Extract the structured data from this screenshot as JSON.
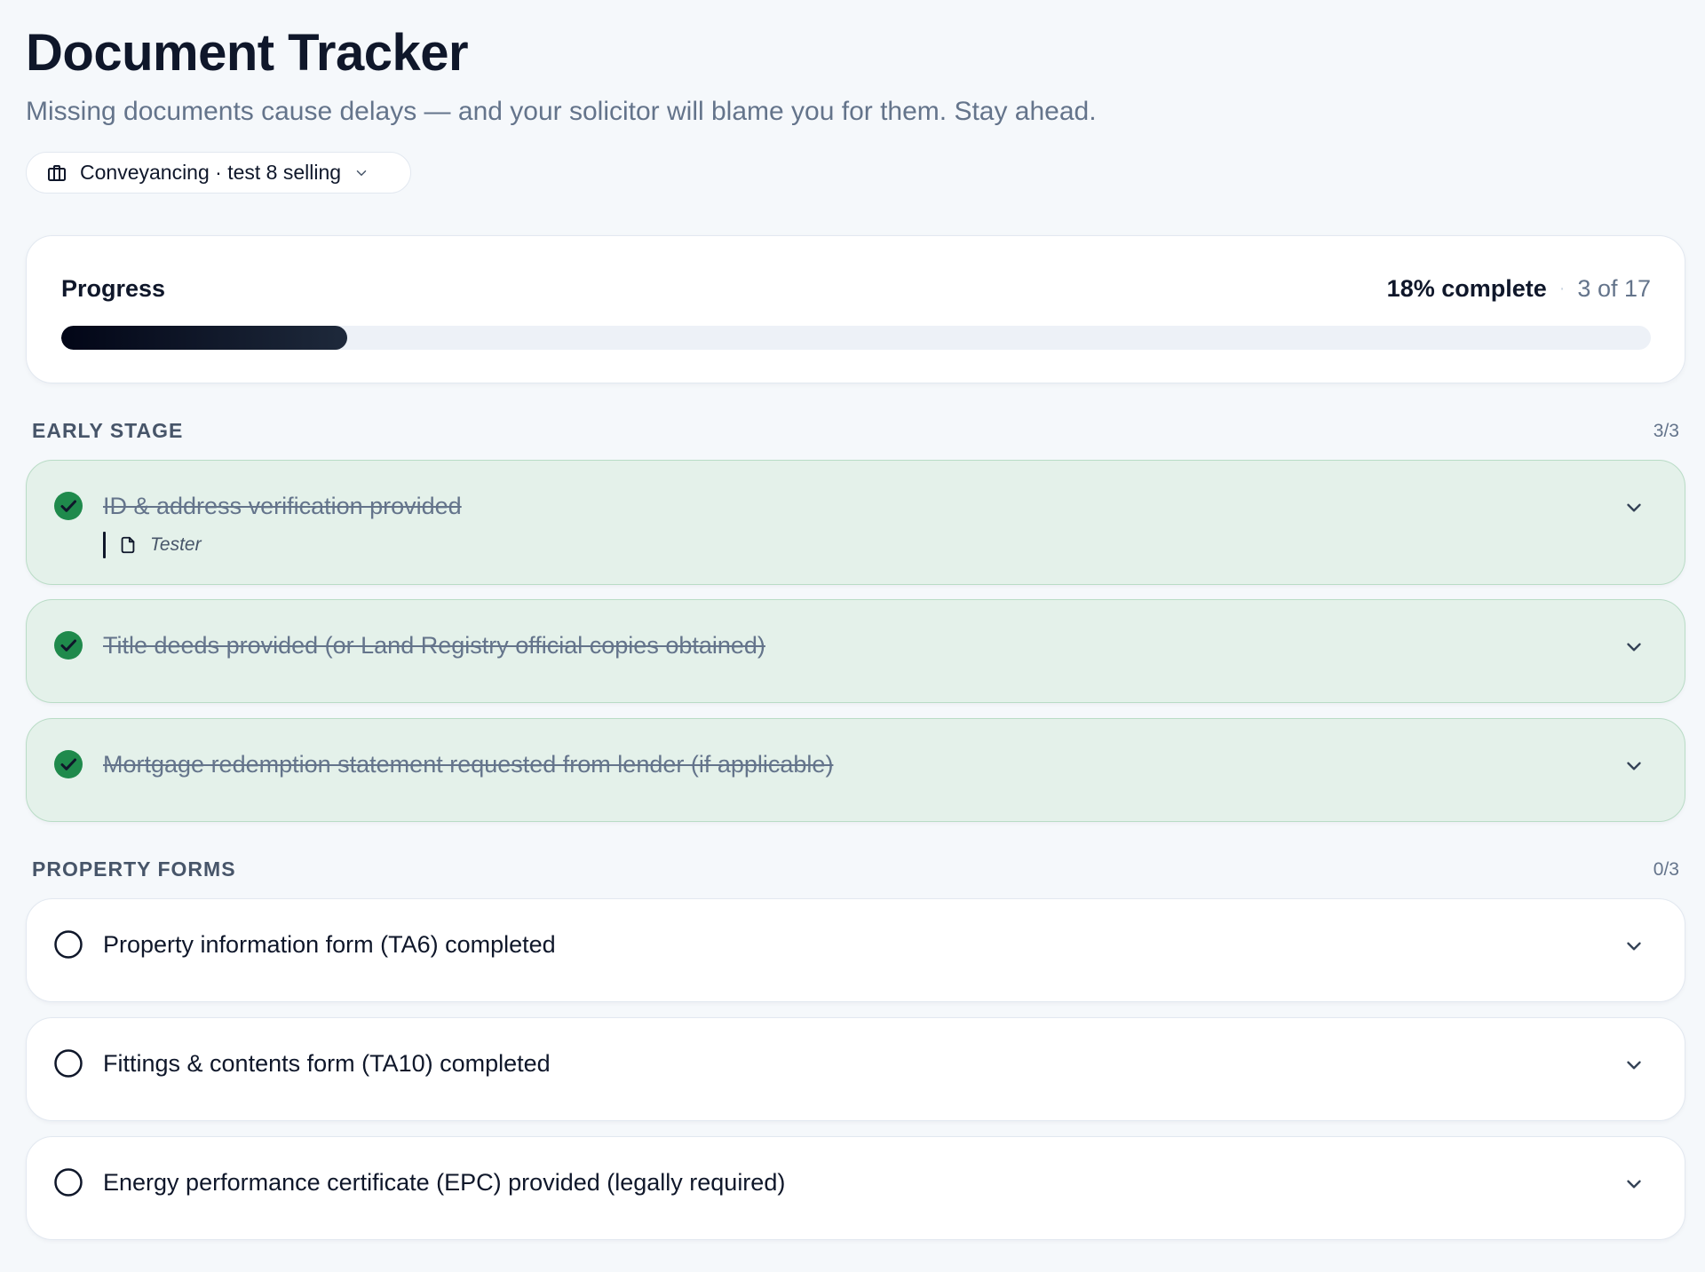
{
  "header": {
    "title": "Document Tracker",
    "subtitle": "Missing documents cause delays — and your solicitor will blame you for them. Stay ahead."
  },
  "case_selector": {
    "icon": "briefcase-icon",
    "label": "Conveyancing · test 8 selling"
  },
  "progress": {
    "label": "Progress",
    "percent_text": "18% complete",
    "count_text": "3 of 17",
    "fraction": 0.18
  },
  "sections": [
    {
      "title": "EARLY STAGE",
      "count": "3/3",
      "items": [
        {
          "label": "ID & address verification provided",
          "done": true,
          "note": "Tester"
        },
        {
          "label": "Title deeds provided (or Land Registry official copies obtained)",
          "done": true
        },
        {
          "label": "Mortgage redemption statement requested from lender (if applicable)",
          "done": true
        }
      ]
    },
    {
      "title": "PROPERTY FORMS",
      "count": "0/3",
      "items": [
        {
          "label": "Property information form (TA6) completed",
          "done": false
        },
        {
          "label": "Fittings & contents form (TA10) completed",
          "done": false
        },
        {
          "label": "Energy performance certificate (EPC) provided (legally required)",
          "done": false
        }
      ]
    }
  ],
  "colors": {
    "done_bg": "#e4f1ea",
    "done_check": "#1f8a4c",
    "accent_dark": "#0f172a"
  }
}
